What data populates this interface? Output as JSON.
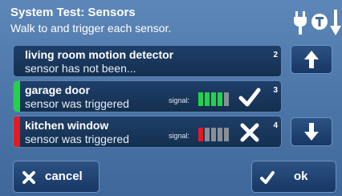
{
  "header": {
    "title": "System Test: Sensors",
    "subtitle": "Walk to and trigger each sensor.",
    "icons": [
      "plug-icon",
      "t-circle-icon",
      "arrow-down-icon"
    ]
  },
  "sensors": [
    {
      "name": "living room motion detector",
      "status": "sensor has not been...",
      "number": "2",
      "stripe_color": "",
      "signal_label": "",
      "signal_bars": 0,
      "result_icon": ""
    },
    {
      "name": "garage door",
      "status": "sensor was triggered",
      "number": "3",
      "stripe_color": "#22d34a",
      "signal_label": "signal:",
      "signal_bars": 4,
      "signal_total": 5,
      "result_icon": "check-icon"
    },
    {
      "name": "kitchen window",
      "status": "sensor was triggered",
      "number": "4",
      "stripe_color": "#e11b24",
      "signal_label": "signal:",
      "signal_bars": 1,
      "signal_total": 5,
      "result_icon": "x-icon"
    }
  ],
  "nav": {
    "up_icon": "arrow-up-icon",
    "down_icon": "arrow-down-icon"
  },
  "buttons": {
    "cancel_label": "cancel",
    "ok_label": "ok"
  },
  "colors": {
    "signal_good": "#22d34a",
    "signal_bad": "#e11b24",
    "signal_off": "#8a8f96"
  }
}
